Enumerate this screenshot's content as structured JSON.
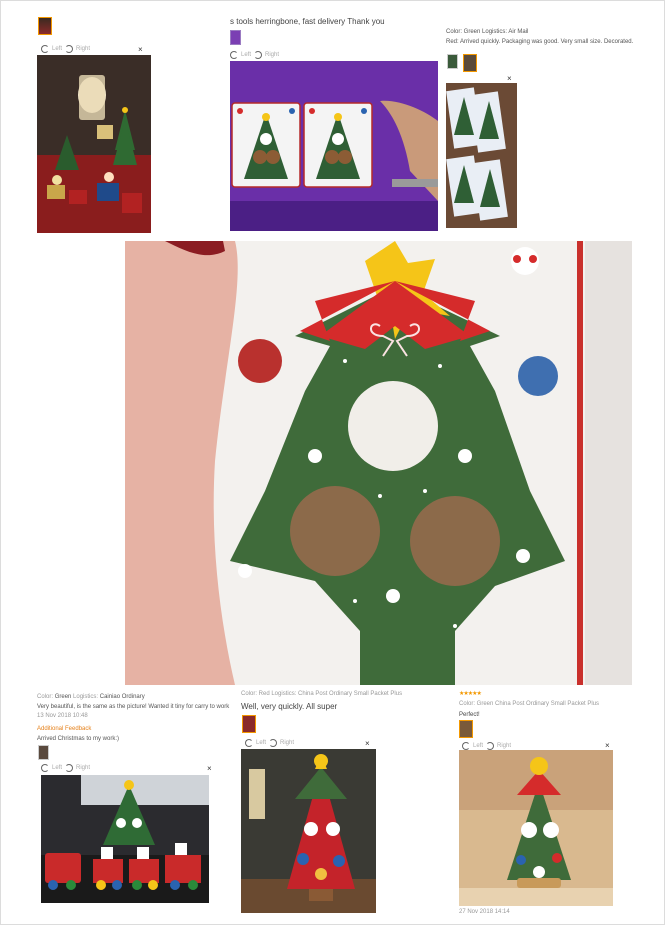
{
  "review_left_top": {
    "rotate_left": "Left",
    "rotate_right": "Right",
    "close": "×"
  },
  "review_mid_top": {
    "comment": "s tools herringbone, fast delivery Thank you",
    "rotate_left": "Left",
    "rotate_right": "Right"
  },
  "review_right_top": {
    "meta": "Color: Green  Logistics: Air Mail",
    "comment": "Red: Arrived quickly. Packaging was good. Very small size. Decorated.",
    "close": "×"
  },
  "review_bottom_left": {
    "meta_label_color": "Color:",
    "meta_color": "Green",
    "meta_label_logistics": "Logistics:",
    "meta_logistics": "Cainiao Ordinary",
    "comment": "Very beautiful, is the same as the picture! Wanted it tiny for carry to work",
    "date": "13 Nov 2018 10:48",
    "additional_label": "Additional Feedback",
    "additional_text": "Arrived Christmas to my work:)",
    "rotate_left": "Left",
    "rotate_right": "Right",
    "close": "×"
  },
  "review_bottom_mid": {
    "meta": "Color: Red   Logistics: China Post Ordinary Small Packet Plus",
    "comment": "Well, very quickly. All super",
    "rotate_left": "Left",
    "rotate_right": "Right",
    "close": "×"
  },
  "review_bottom_right": {
    "stars": "★★★★★",
    "meta": "Color: Green   China Post Ordinary Small Packet Plus",
    "comment": "Perfect!",
    "rotate_left": "Left",
    "rotate_right": "Right",
    "close": "×",
    "date": "27 Nov 2018 14:14"
  },
  "colors": {
    "accent": "#f39800",
    "tree_green": "#3f6b3a",
    "tree_red": "#d52b2b",
    "star_yellow": "#f5c518",
    "purple_mat": "#7b3fb3"
  }
}
